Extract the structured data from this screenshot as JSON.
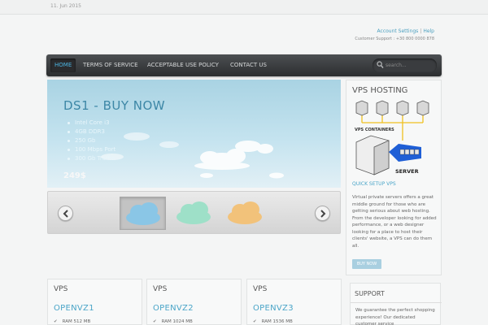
{
  "topbar": {
    "date": "11. Jun 2015"
  },
  "account": {
    "settings_label": "Account Settings",
    "help_label": "Help",
    "support_line": "Customer Support : +30 800 0000 878"
  },
  "nav": {
    "items": [
      {
        "label": "HOME",
        "active": true
      },
      {
        "label": "TERMS OF SERVICE"
      },
      {
        "label": "ACCEPTABLE USE POLICY"
      },
      {
        "label": "CONTACT US"
      }
    ],
    "search_placeholder": "search..."
  },
  "slider": {
    "headline": "DS1 - BUY NOW",
    "features": [
      "Intel Core i3",
      "4GB DDR3",
      "250 Gb",
      "100 Mbps Port",
      "300 Gb Traffic"
    ],
    "price": "249$"
  },
  "sidebar": {
    "title": "VPS HOSTING",
    "diagram": {
      "containers_label": "VPS CONTAINERS",
      "server_label": "SERVER"
    },
    "link": "QUICK SETUP VPS",
    "description": "Virtual private servers offers a great middle ground for those who are getting serious about web hosting. From the developer looking for added performance, or a web designer looking for a place to host their clients' website, a VPS can do them all.",
    "button": "BUY NOW"
  },
  "plans": [
    {
      "title": "VPS",
      "name": "OPENVZ1",
      "feature": "RAM 512 MB"
    },
    {
      "title": "VPS",
      "name": "OPENVZ2",
      "feature": "RAM 1024 MB"
    },
    {
      "title": "VPS",
      "name": "OPENVZ3",
      "feature": "RAM 1536 MB"
    }
  ],
  "support": {
    "title": "SUPPORT",
    "text": "We guarantee the perfect shopping experience! Our dedicated customer service"
  },
  "colors": {
    "accent": "#4aa5c8",
    "nav_dark": "#2c2e30",
    "nav_active_text": "#4bb3e0"
  }
}
